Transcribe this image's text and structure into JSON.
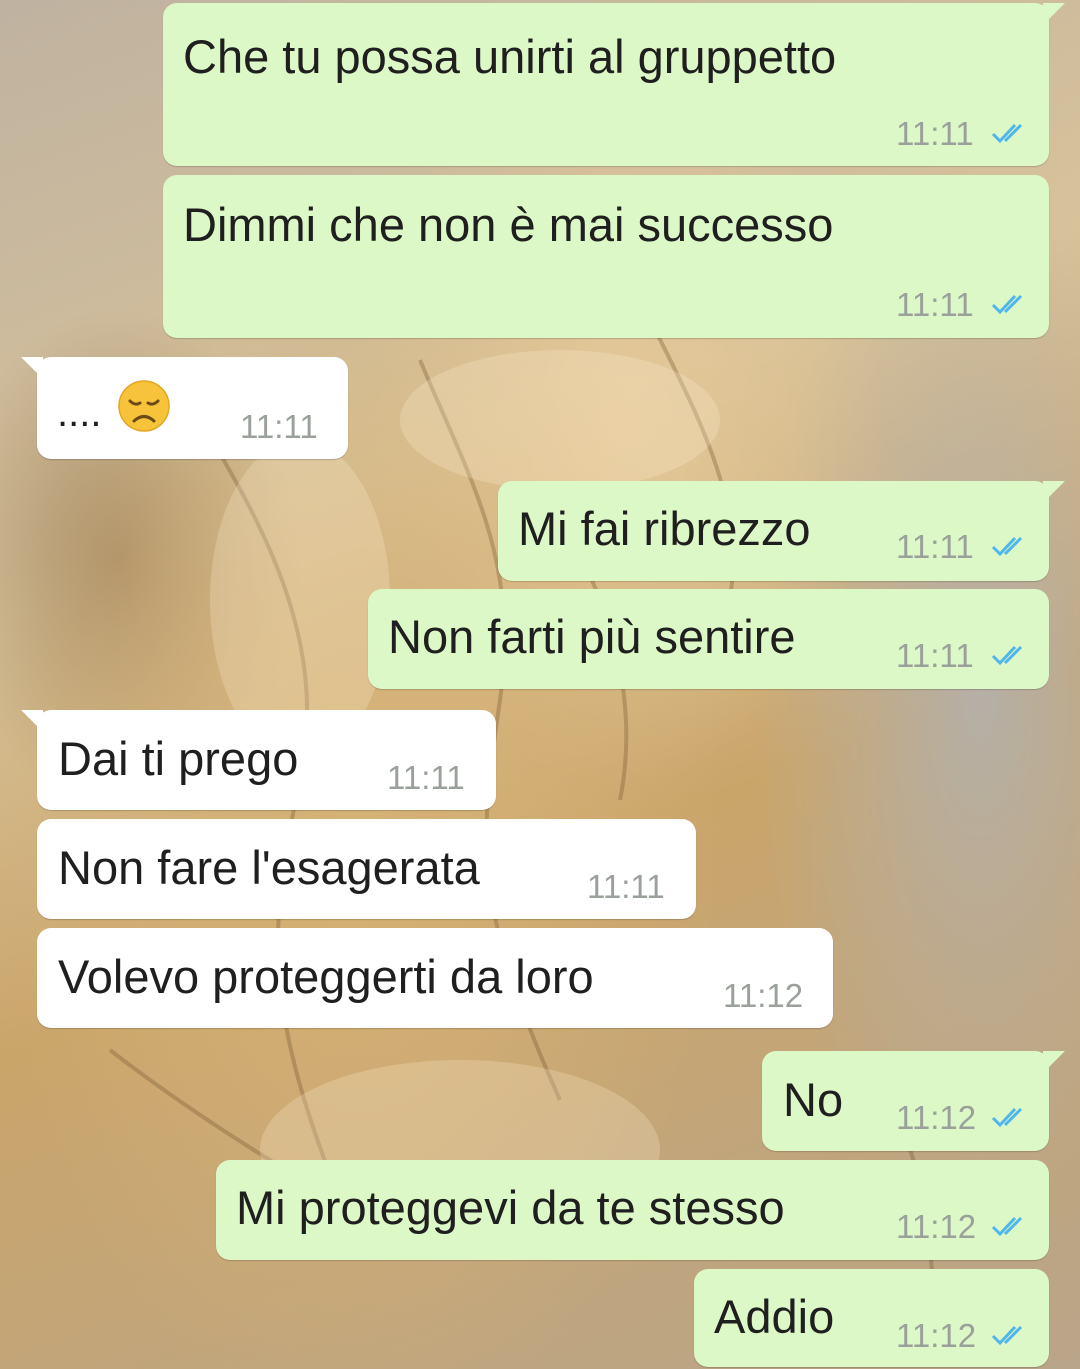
{
  "conversation": {
    "messages": [
      {
        "direction": "out",
        "text": "Che tu possa unirti al gruppetto",
        "time": "11:11",
        "status_icon": "double-check-read-icon"
      },
      {
        "direction": "out",
        "text": "Dimmi che non è mai successo",
        "time": "11:11",
        "status_icon": "double-check-read-icon"
      },
      {
        "direction": "in",
        "text": "....",
        "emoji": "disappointed-face-emoji",
        "time": "11:11"
      },
      {
        "direction": "out",
        "text": "Mi fai ribrezzo",
        "time": "11:11",
        "status_icon": "double-check-read-icon"
      },
      {
        "direction": "out",
        "text": "Non farti più sentire",
        "time": "11:11",
        "status_icon": "double-check-read-icon"
      },
      {
        "direction": "in",
        "text": "Dai ti prego",
        "time": "11:11"
      },
      {
        "direction": "in",
        "text": "Non fare l'esagerata",
        "time": "11:11"
      },
      {
        "direction": "in",
        "text": "Volevo proteggerti da loro",
        "time": "11:12"
      },
      {
        "direction": "out",
        "text": "No",
        "time": "11:12",
        "status_icon": "double-check-read-icon"
      },
      {
        "direction": "out",
        "text": "Mi proteggevi da te stesso",
        "time": "11:12",
        "status_icon": "double-check-read-icon"
      },
      {
        "direction": "out",
        "text": "Addio",
        "time": "11:12",
        "status_icon": "double-check-read-icon"
      }
    ]
  },
  "colors": {
    "outgoing_bubble": "#dcf8c6",
    "incoming_bubble": "#ffffff",
    "read_ticks": "#4fb6ec",
    "timestamp": "#9aa09a"
  }
}
